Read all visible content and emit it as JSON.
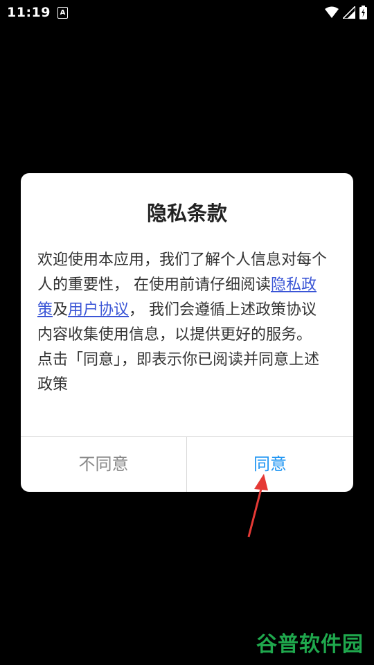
{
  "status_bar": {
    "time": "11:19",
    "notif_letter": "A"
  },
  "dialog": {
    "title": "隐私条款",
    "body_part1": "欢迎使用本应用，我们了解个人信息对每个人的重要性， 在使用前请仔细阅读",
    "link_privacy": "隐私政策",
    "conj": "及",
    "link_agreement": "用户协议",
    "body_part2": "， 我们会遵循上述政策协议内容收集使用信息，以提供更好的服务。",
    "body_part3": "点击「同意」，即表示你已阅读并同意上述政策",
    "btn_disagree": "不同意",
    "btn_agree": "同意"
  },
  "watermark": "谷普软件园",
  "colors": {
    "link": "#3a55d6",
    "agree": "#2196f3",
    "arrow": "#e53935",
    "watermark": "#1fa84d"
  }
}
